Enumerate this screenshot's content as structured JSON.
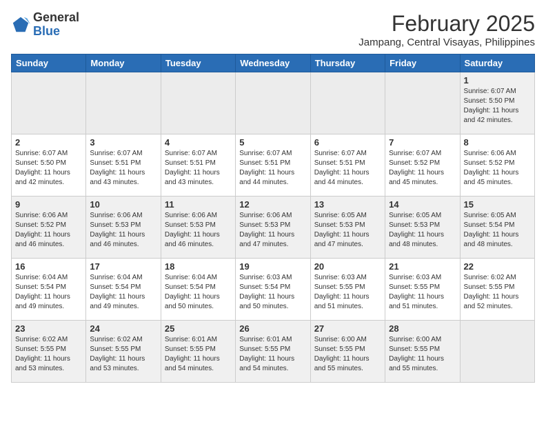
{
  "logo": {
    "general": "General",
    "blue": "Blue"
  },
  "title": "February 2025",
  "subtitle": "Jampang, Central Visayas, Philippines",
  "days_of_week": [
    "Sunday",
    "Monday",
    "Tuesday",
    "Wednesday",
    "Thursday",
    "Friday",
    "Saturday"
  ],
  "weeks": [
    [
      {
        "day": "",
        "info": ""
      },
      {
        "day": "",
        "info": ""
      },
      {
        "day": "",
        "info": ""
      },
      {
        "day": "",
        "info": ""
      },
      {
        "day": "",
        "info": ""
      },
      {
        "day": "",
        "info": ""
      },
      {
        "day": "1",
        "info": "Sunrise: 6:07 AM\nSunset: 5:50 PM\nDaylight: 11 hours\nand 42 minutes."
      }
    ],
    [
      {
        "day": "2",
        "info": "Sunrise: 6:07 AM\nSunset: 5:50 PM\nDaylight: 11 hours\nand 42 minutes."
      },
      {
        "day": "3",
        "info": "Sunrise: 6:07 AM\nSunset: 5:51 PM\nDaylight: 11 hours\nand 43 minutes."
      },
      {
        "day": "4",
        "info": "Sunrise: 6:07 AM\nSunset: 5:51 PM\nDaylight: 11 hours\nand 43 minutes."
      },
      {
        "day": "5",
        "info": "Sunrise: 6:07 AM\nSunset: 5:51 PM\nDaylight: 11 hours\nand 44 minutes."
      },
      {
        "day": "6",
        "info": "Sunrise: 6:07 AM\nSunset: 5:51 PM\nDaylight: 11 hours\nand 44 minutes."
      },
      {
        "day": "7",
        "info": "Sunrise: 6:07 AM\nSunset: 5:52 PM\nDaylight: 11 hours\nand 45 minutes."
      },
      {
        "day": "8",
        "info": "Sunrise: 6:06 AM\nSunset: 5:52 PM\nDaylight: 11 hours\nand 45 minutes."
      }
    ],
    [
      {
        "day": "9",
        "info": "Sunrise: 6:06 AM\nSunset: 5:52 PM\nDaylight: 11 hours\nand 46 minutes."
      },
      {
        "day": "10",
        "info": "Sunrise: 6:06 AM\nSunset: 5:53 PM\nDaylight: 11 hours\nand 46 minutes."
      },
      {
        "day": "11",
        "info": "Sunrise: 6:06 AM\nSunset: 5:53 PM\nDaylight: 11 hours\nand 46 minutes."
      },
      {
        "day": "12",
        "info": "Sunrise: 6:06 AM\nSunset: 5:53 PM\nDaylight: 11 hours\nand 47 minutes."
      },
      {
        "day": "13",
        "info": "Sunrise: 6:05 AM\nSunset: 5:53 PM\nDaylight: 11 hours\nand 47 minutes."
      },
      {
        "day": "14",
        "info": "Sunrise: 6:05 AM\nSunset: 5:53 PM\nDaylight: 11 hours\nand 48 minutes."
      },
      {
        "day": "15",
        "info": "Sunrise: 6:05 AM\nSunset: 5:54 PM\nDaylight: 11 hours\nand 48 minutes."
      }
    ],
    [
      {
        "day": "16",
        "info": "Sunrise: 6:04 AM\nSunset: 5:54 PM\nDaylight: 11 hours\nand 49 minutes."
      },
      {
        "day": "17",
        "info": "Sunrise: 6:04 AM\nSunset: 5:54 PM\nDaylight: 11 hours\nand 49 minutes."
      },
      {
        "day": "18",
        "info": "Sunrise: 6:04 AM\nSunset: 5:54 PM\nDaylight: 11 hours\nand 50 minutes."
      },
      {
        "day": "19",
        "info": "Sunrise: 6:03 AM\nSunset: 5:54 PM\nDaylight: 11 hours\nand 50 minutes."
      },
      {
        "day": "20",
        "info": "Sunrise: 6:03 AM\nSunset: 5:55 PM\nDaylight: 11 hours\nand 51 minutes."
      },
      {
        "day": "21",
        "info": "Sunrise: 6:03 AM\nSunset: 5:55 PM\nDaylight: 11 hours\nand 51 minutes."
      },
      {
        "day": "22",
        "info": "Sunrise: 6:02 AM\nSunset: 5:55 PM\nDaylight: 11 hours\nand 52 minutes."
      }
    ],
    [
      {
        "day": "23",
        "info": "Sunrise: 6:02 AM\nSunset: 5:55 PM\nDaylight: 11 hours\nand 53 minutes."
      },
      {
        "day": "24",
        "info": "Sunrise: 6:02 AM\nSunset: 5:55 PM\nDaylight: 11 hours\nand 53 minutes."
      },
      {
        "day": "25",
        "info": "Sunrise: 6:01 AM\nSunset: 5:55 PM\nDaylight: 11 hours\nand 54 minutes."
      },
      {
        "day": "26",
        "info": "Sunrise: 6:01 AM\nSunset: 5:55 PM\nDaylight: 11 hours\nand 54 minutes."
      },
      {
        "day": "27",
        "info": "Sunrise: 6:00 AM\nSunset: 5:55 PM\nDaylight: 11 hours\nand 55 minutes."
      },
      {
        "day": "28",
        "info": "Sunrise: 6:00 AM\nSunset: 5:55 PM\nDaylight: 11 hours\nand 55 minutes."
      },
      {
        "day": "",
        "info": ""
      }
    ]
  ]
}
